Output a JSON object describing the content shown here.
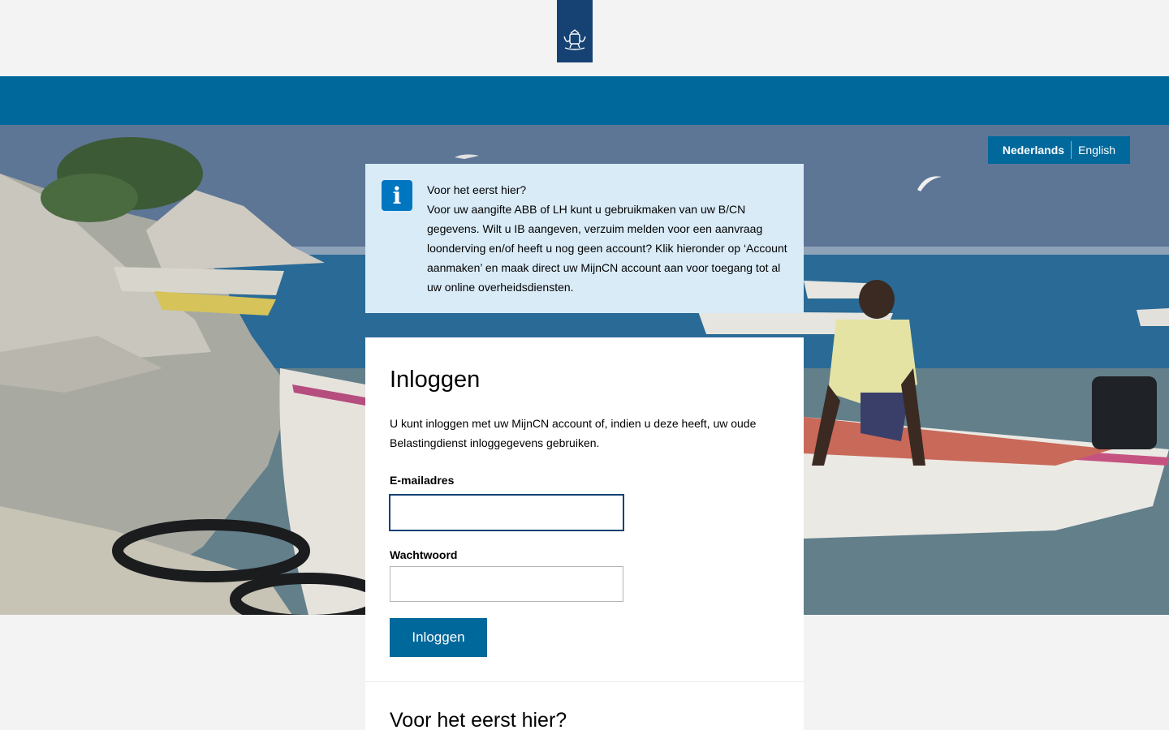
{
  "header": {
    "logo_icon": "coat-of-arms-icon"
  },
  "language": {
    "nl": "Nederlands",
    "en": "English"
  },
  "info": {
    "icon": "info-icon",
    "title": "Voor het eerst hier?",
    "body": "Voor uw aangifte ABB of LH kunt u gebruikmaken van uw B/CN gegevens. Wilt u IB aangeven, verzuim melden voor een aanvraag loonderving en/of heeft u nog geen account? Klik hieronder op ‘Account aanmaken’ en maak direct uw MijnCN account aan voor toegang tot al uw online overheidsdiensten."
  },
  "login": {
    "title": "Inloggen",
    "intro": "U kunt inloggen met uw MijnCN account of, indien u deze heeft, uw oude Belastingdienst inloggegevens gebruiken.",
    "email_label": "E-mailadres",
    "email_value": "",
    "password_label": "Wachtwoord",
    "password_value": "",
    "button": "Inloggen"
  },
  "first_time": {
    "title": "Voor het eerst hier?"
  },
  "colors": {
    "brand_blue": "#01689b",
    "logo_blue": "#154273",
    "info_bg": "#d9ebf7"
  }
}
